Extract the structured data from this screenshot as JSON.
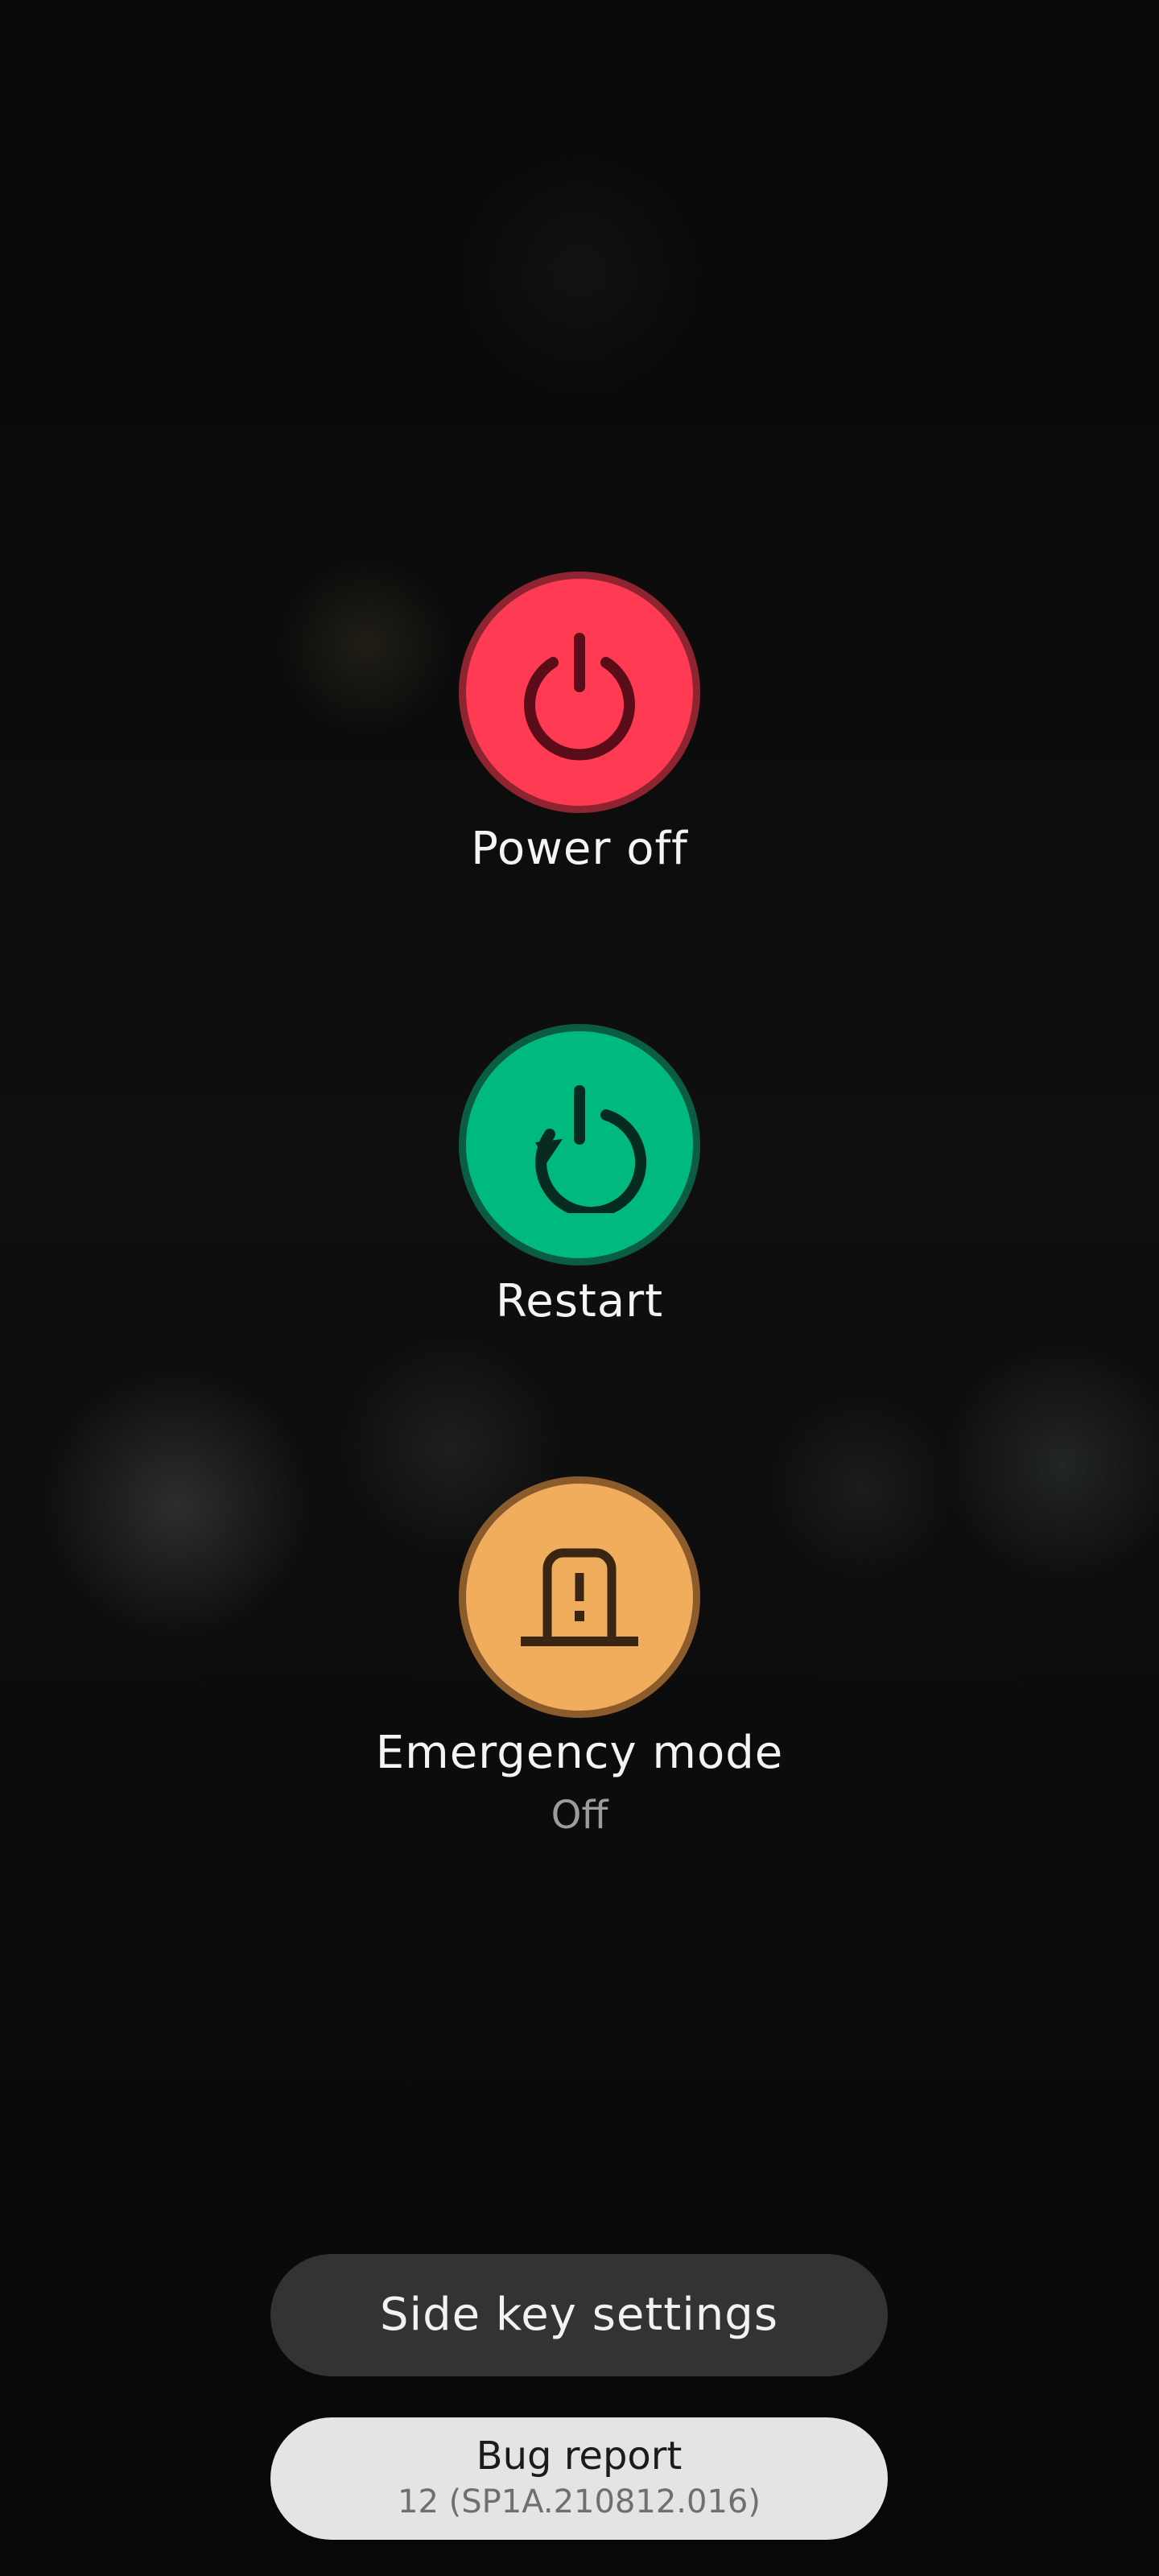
{
  "actions": {
    "power_off": {
      "label": "Power off",
      "color": "#fe3b53",
      "icon": "power-icon"
    },
    "restart": {
      "label": "Restart",
      "color": "#00b97f",
      "icon": "restart-icon"
    },
    "emergency": {
      "label": "Emergency mode",
      "status": "Off",
      "color": "#f0ae5c",
      "icon": "emergency-mode-icon"
    }
  },
  "buttons": {
    "side_key_settings": "Side key settings",
    "bug_report": {
      "title": "Bug report",
      "version": "12 (SP1A.210812.016)"
    }
  }
}
